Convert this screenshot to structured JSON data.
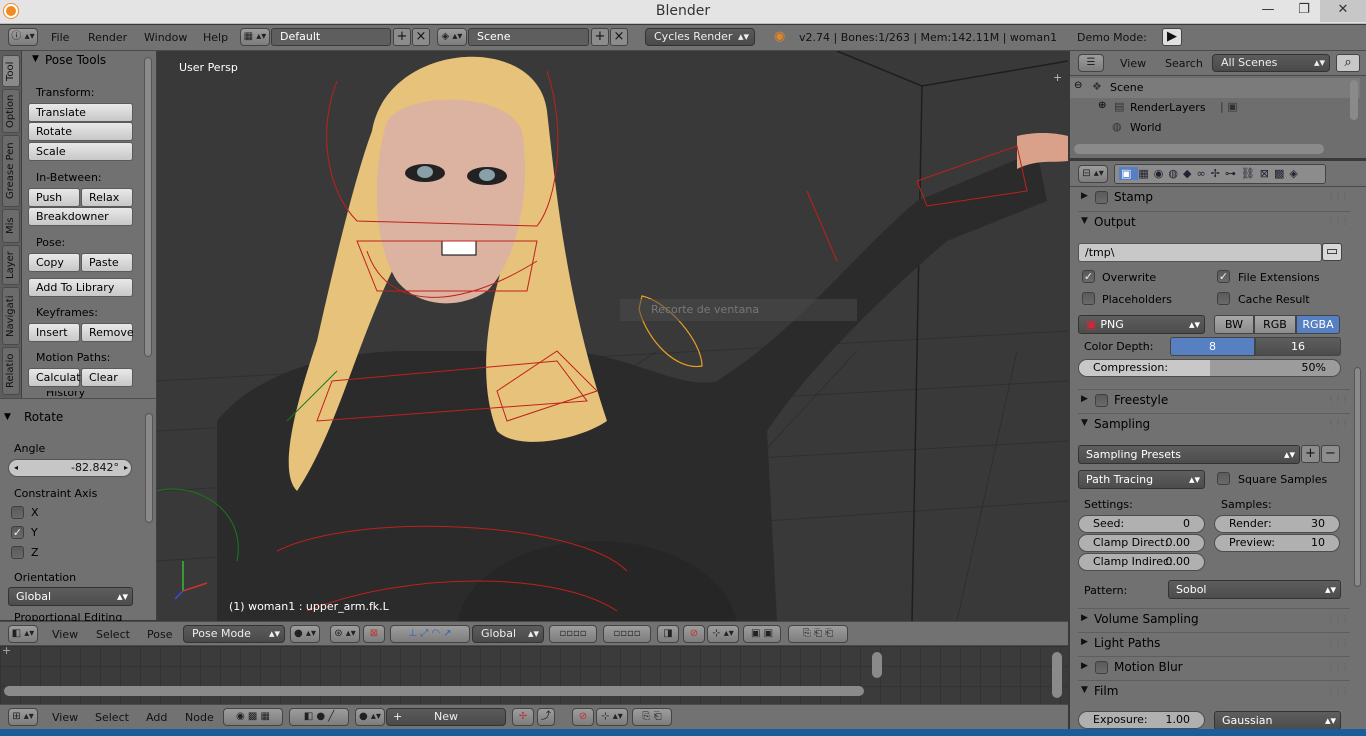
{
  "window": {
    "title": "Blender",
    "minimize": "—",
    "maximize": "❐",
    "close": "✕"
  },
  "infobar": {
    "menus": [
      "File",
      "Render",
      "Window",
      "Help"
    ],
    "layout": "Default",
    "scene": "Scene",
    "engine": "Cycles Render",
    "stats": "v2.74 | Bones:1/263 | Mem:142.11M | woman1",
    "demo_mode": "Demo Mode:"
  },
  "toolshelf": {
    "tabs": [
      "Tool",
      "Option",
      "Grease Pen",
      "Mis",
      "Layer",
      "Navigati",
      "Relatio"
    ],
    "panel_title": "Pose Tools",
    "transform_label": "Transform:",
    "translate": "Translate",
    "rotate": "Rotate",
    "scale": "Scale",
    "inbetween_label": "In-Between:",
    "push": "Push",
    "relax": "Relax",
    "breakdowner": "Breakdowner",
    "pose_label": "Pose:",
    "copy": "Copy",
    "paste": "Paste",
    "add_to_library": "Add To Library",
    "keyframes_label": "Keyframes:",
    "insert": "Insert",
    "remove": "Remove",
    "motion_paths_label": "Motion Paths:",
    "calculate": "Calculat",
    "clear": "Clear",
    "history": "History"
  },
  "operator": {
    "title": "Rotate",
    "angle_label": "Angle",
    "angle_value": "-82.842°",
    "constraint_label": "Constraint Axis",
    "x": "X",
    "y": "Y",
    "z": "Z",
    "x_checked": false,
    "y_checked": true,
    "z_checked": false,
    "orientation_label": "Orientation",
    "orientation_value": "Global",
    "proportional": "Proportional Editing"
  },
  "viewport": {
    "view_name": "User Persp",
    "status": "(1) woman1 : upper_arm.fk.L",
    "tooltip": "Recorte de ventana"
  },
  "viewport_header": {
    "menus": [
      "View",
      "Select",
      "Pose"
    ],
    "mode": "Pose Mode",
    "orientation": "Global"
  },
  "node_header": {
    "menus": [
      "View",
      "Select",
      "Add",
      "Node"
    ],
    "new_button": "New"
  },
  "outliner": {
    "view": "View",
    "search": "Search",
    "filter": "All Scenes",
    "items": [
      "Scene",
      "RenderLayers",
      "World"
    ]
  },
  "properties": {
    "stamp": "Stamp",
    "output": "Output",
    "path": "/tmp\\",
    "overwrite": "Overwrite",
    "file_extensions": "File Extensions",
    "placeholders": "Placeholders",
    "cache_result": "Cache Result",
    "format": "PNG",
    "bw": "BW",
    "rgb": "RGB",
    "rgba": "RGBA",
    "color_depth_label": "Color Depth:",
    "depth_8": "8",
    "depth_16": "16",
    "compression_label": "Compression:",
    "compression_value": "50%",
    "compression_fraction": 0.5,
    "freestyle": "Freestyle",
    "sampling": "Sampling",
    "sampling_presets": "Sampling Presets",
    "integrator": "Path Tracing",
    "square_samples": "Square Samples",
    "settings_label": "Settings:",
    "samples_label": "Samples:",
    "seed_label": "Seed:",
    "seed_value": "0",
    "clamp_direct_label": "Clamp Direct:",
    "clamp_direct_value": "0.00",
    "clamp_indirect_label": "Clamp Indirec:",
    "clamp_indirect_value": "0.00",
    "render_label": "Render:",
    "render_value": "30",
    "preview_label": "Preview:",
    "preview_value": "10",
    "pattern_label": "Pattern:",
    "pattern_value": "Sobol",
    "volume_sampling": "Volume Sampling",
    "light_paths": "Light Paths",
    "motion_blur": "Motion Blur",
    "film": "Film",
    "exposure_label": "Exposure:",
    "exposure_value": "1.00",
    "filter": "Gaussian"
  },
  "colors": {
    "panel": "#717171",
    "viewport_bg": "#393939",
    "accent_blue": "#5680c2",
    "bone_red": "#c0201c",
    "selected_bone": "#e8a020"
  }
}
